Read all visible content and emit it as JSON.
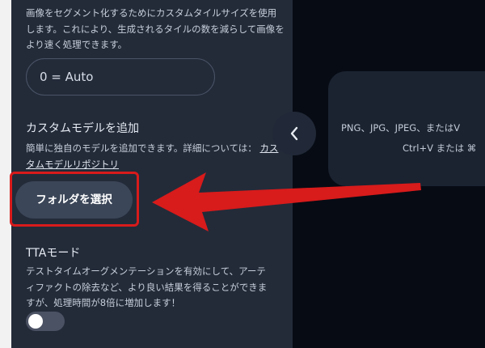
{
  "settings": {
    "tile_size_description": "画像をセグメント化するためにカスタムタイルサイズを使用します。これにより、生成されるタイルの数を減らして画像をより速く処理できます。",
    "tile_size_value": "0 = Auto",
    "custom_model": {
      "heading": "カスタムモデルを追加",
      "description": "簡単に独自のモデルを追加できます。詳細については：",
      "link_label": "カスタムモデルリポジトリ",
      "button_label": "フォルダを選択"
    },
    "tta": {
      "heading": "TTAモード",
      "description": "テストタイムオーグメンテーションを有効にして、アーティファクトの除去など、より良い結果を得ることができますが、処理時間が8倍に増加します！",
      "enabled": false
    }
  },
  "drop_area": {
    "line1": "PNG、JPG、JPEG、またはV",
    "line2": "Ctrl+V または ⌘"
  },
  "icons": {
    "collapse": "chevron-left-icon",
    "annotation": "red-arrow"
  },
  "colors": {
    "highlight": "#d81b1b",
    "sidebar": "#232b39",
    "background": "#070b14"
  }
}
